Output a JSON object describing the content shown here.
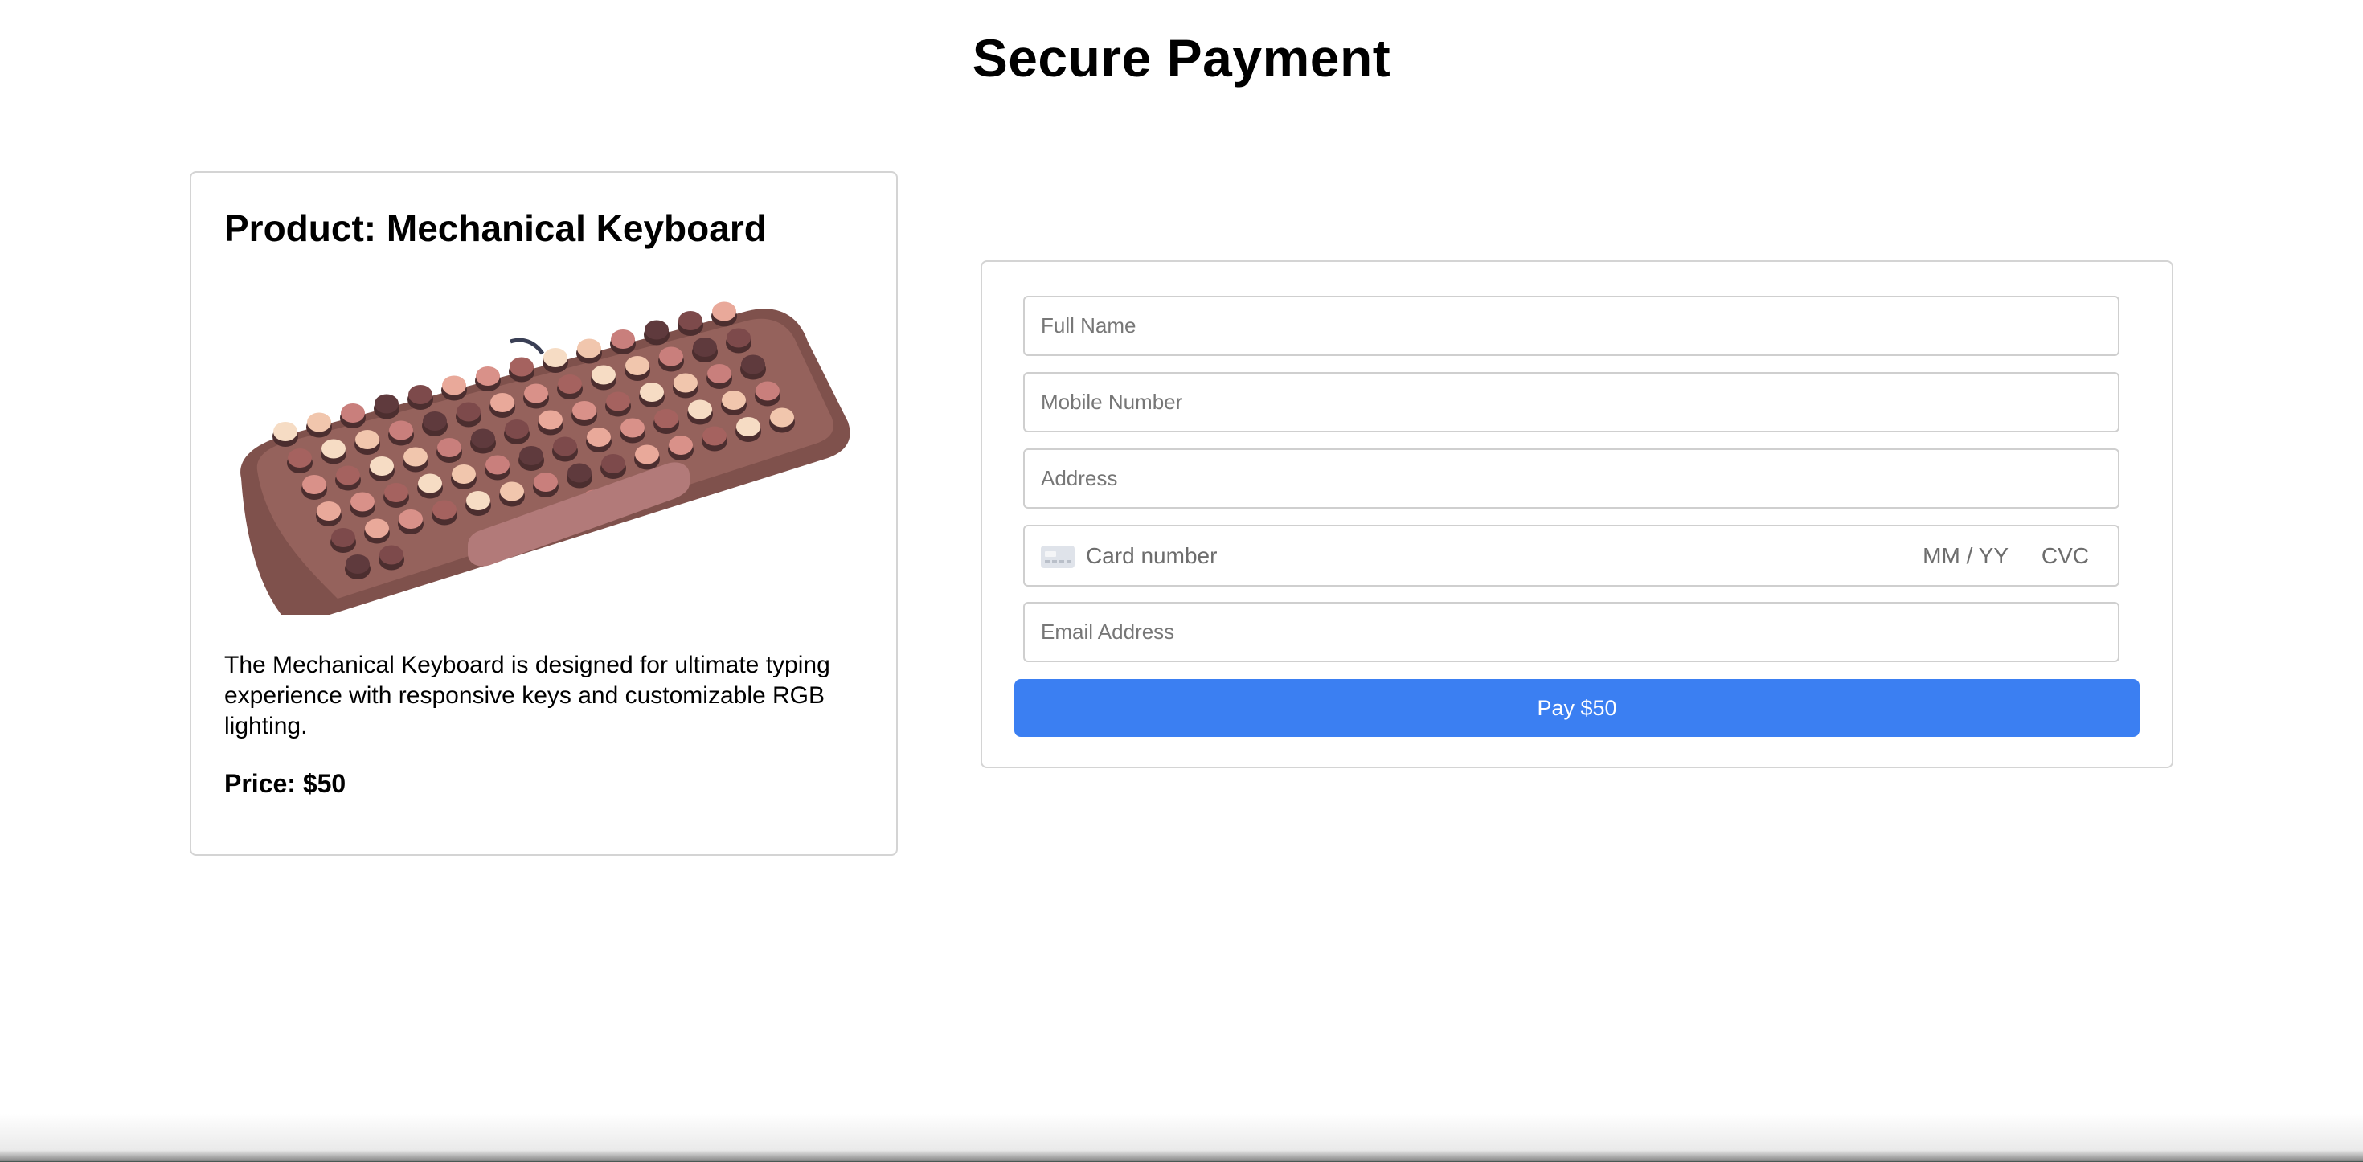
{
  "page": {
    "title": "Secure Payment"
  },
  "product": {
    "title": "Product: Mechanical Keyboard",
    "image_name": "mechanical-keyboard",
    "description": "The Mechanical Keyboard is designed for ultimate typing experience with responsive keys and customizable RGB lighting.",
    "price": "Price: $50"
  },
  "form": {
    "full_name_placeholder": "Full Name",
    "mobile_placeholder": "Mobile Number",
    "address_placeholder": "Address",
    "card": {
      "icon": "credit-card-icon",
      "number_placeholder": "Card number",
      "expiry_placeholder": "MM / YY",
      "cvc_placeholder": "CVC"
    },
    "email_placeholder": "Email Address",
    "pay_label": "Pay $50"
  },
  "colors": {
    "pay_button": "#3b7ff2",
    "border": "#d4d4d4",
    "keyboard_body": "#8a5a56"
  }
}
